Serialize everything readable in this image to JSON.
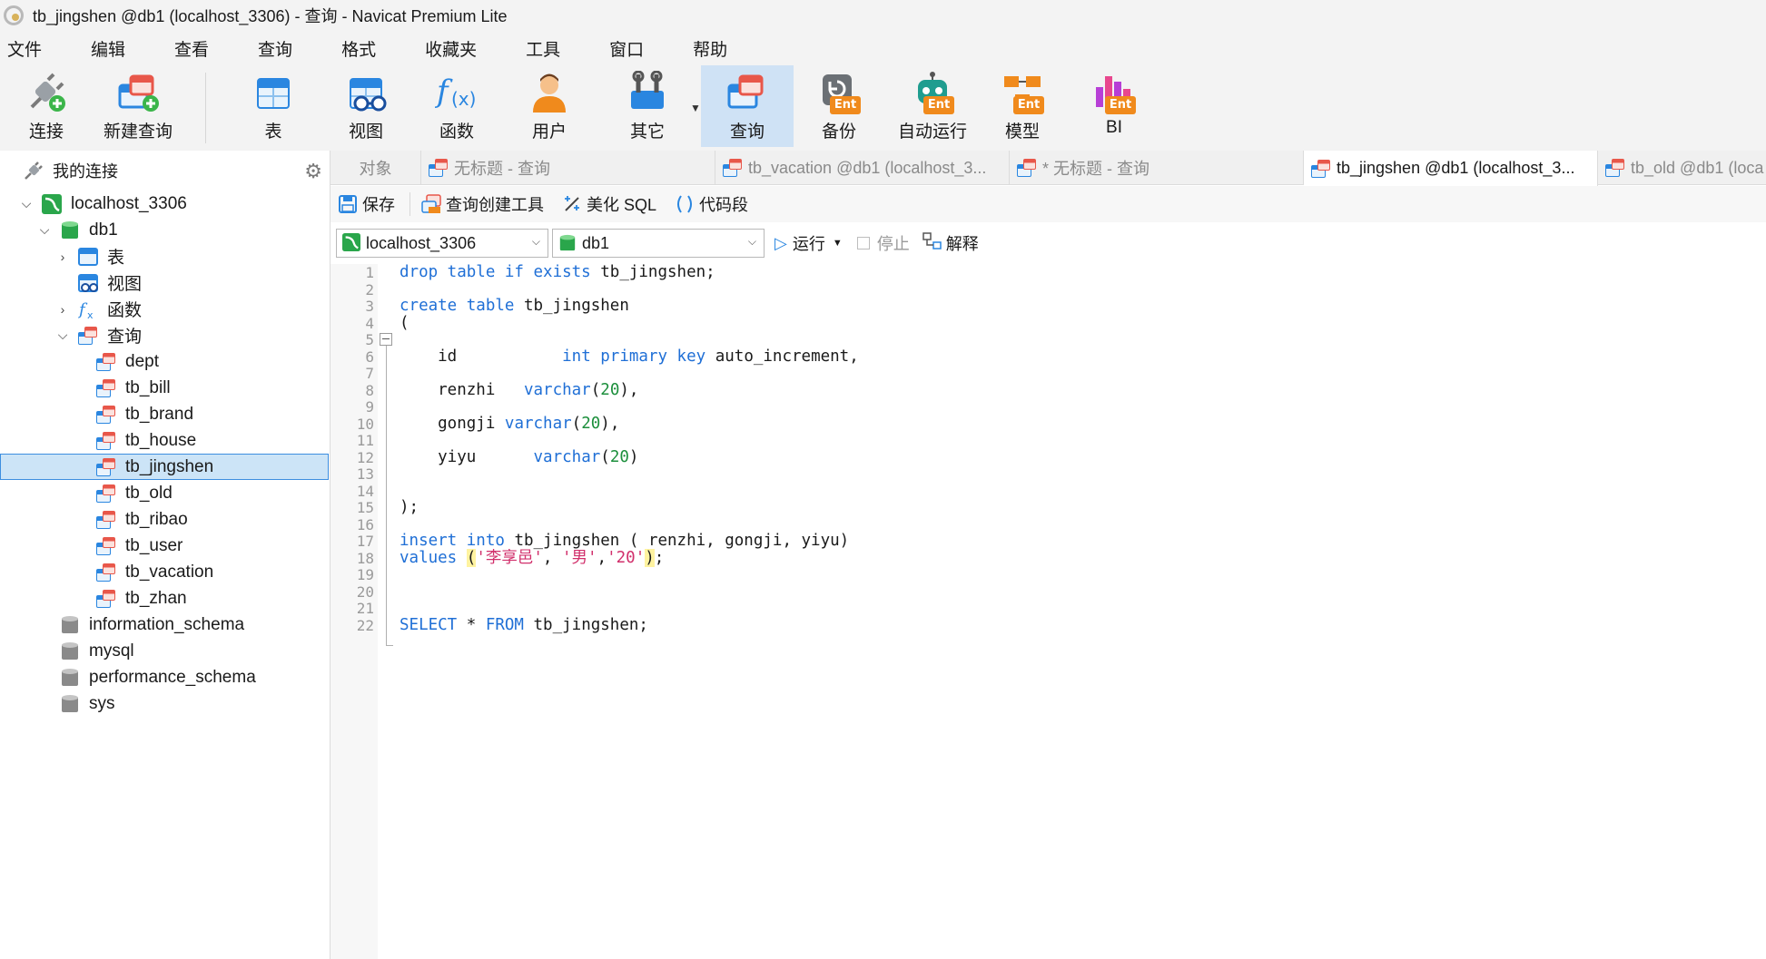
{
  "window": {
    "title": "tb_jingshen @db1 (localhost_3306) - 查询 - Navicat Premium Lite"
  },
  "menu": [
    "文件",
    "编辑",
    "查看",
    "查询",
    "格式",
    "收藏夹",
    "工具",
    "窗口",
    "帮助"
  ],
  "toolbar": {
    "connect": "连接",
    "new_query": "新建查询",
    "table": "表",
    "view": "视图",
    "function": "函数",
    "user": "用户",
    "other": "其它",
    "query": "查询",
    "backup": "备份",
    "automation": "自动运行",
    "model": "模型",
    "bi": "BI",
    "ent_badge": "Ent"
  },
  "sidebar": {
    "header": "我的连接",
    "connection": "localhost_3306",
    "database": "db1",
    "nodes": {
      "tables": "表",
      "views": "视图",
      "functions": "函数",
      "queries": "查询"
    },
    "queries": [
      "dept",
      "tb_bill",
      "tb_brand",
      "tb_house",
      "tb_jingshen",
      "tb_old",
      "tb_ribao",
      "tb_user",
      "tb_vacation",
      "tb_zhan"
    ],
    "selected_query": "tb_jingshen",
    "other_databases": [
      "information_schema",
      "mysql",
      "performance_schema",
      "sys"
    ]
  },
  "tabs": [
    {
      "label": "对象",
      "active": false
    },
    {
      "label": "无标题 - 查询",
      "active": false
    },
    {
      "label": "tb_vacation @db1 (localhost_3...",
      "active": false
    },
    {
      "label": "* 无标题 - 查询",
      "active": false
    },
    {
      "label": "tb_jingshen @db1 (localhost_3...",
      "active": true
    },
    {
      "label": "tb_old @db1 (loca",
      "active": false
    }
  ],
  "query_toolbar": {
    "save": "保存",
    "query_builder": "查询创建工具",
    "beautify": "美化 SQL",
    "snippet": "代码段",
    "connection_value": "localhost_3306",
    "database_value": "db1",
    "run": "运行",
    "stop": "停止",
    "explain": "解释"
  },
  "editor": {
    "lines": [
      {
        "n": "1",
        "tokens": [
          [
            "kw",
            "drop table if exists"
          ],
          [
            "id",
            " tb_jingshen;"
          ]
        ]
      },
      {
        "n": "2",
        "tokens": []
      },
      {
        "n": "3",
        "tokens": [
          [
            "kw",
            "create table"
          ],
          [
            "id",
            " tb_jingshen"
          ]
        ]
      },
      {
        "n": "4",
        "tokens": [
          [
            "id",
            "("
          ]
        ]
      },
      {
        "n": "5",
        "tokens": []
      },
      {
        "n": "6",
        "tokens": [
          [
            "id",
            "    id           "
          ],
          [
            "kw",
            "int primary key"
          ],
          [
            "id",
            " auto_increment,"
          ]
        ]
      },
      {
        "n": "7",
        "tokens": []
      },
      {
        "n": "8",
        "tokens": [
          [
            "id",
            "    renzhi   "
          ],
          [
            "kw",
            "varchar"
          ],
          [
            "id",
            "("
          ],
          [
            "num",
            "20"
          ],
          [
            "id",
            "),"
          ]
        ]
      },
      {
        "n": "9",
        "tokens": []
      },
      {
        "n": "10",
        "tokens": [
          [
            "id",
            "    gongji "
          ],
          [
            "kw",
            "varchar"
          ],
          [
            "id",
            "("
          ],
          [
            "num",
            "20"
          ],
          [
            "id",
            "),"
          ]
        ]
      },
      {
        "n": "11",
        "tokens": []
      },
      {
        "n": "12",
        "tokens": [
          [
            "id",
            "    yiyu      "
          ],
          [
            "kw",
            "varchar"
          ],
          [
            "id",
            "("
          ],
          [
            "num",
            "20"
          ],
          [
            "id",
            ")"
          ]
        ]
      },
      {
        "n": "13",
        "tokens": []
      },
      {
        "n": "14",
        "tokens": []
      },
      {
        "n": "15",
        "tokens": [
          [
            "id",
            ");"
          ]
        ]
      },
      {
        "n": "16",
        "tokens": []
      },
      {
        "n": "17",
        "tokens": [
          [
            "kw",
            "insert into"
          ],
          [
            "id",
            " tb_jingshen ( renzhi, gongji, yiyu)"
          ]
        ]
      },
      {
        "n": "18",
        "tokens": [
          [
            "kw",
            "values"
          ],
          [
            "id",
            " "
          ],
          [
            "hl",
            "("
          ],
          [
            "str",
            "'李享邑'"
          ],
          [
            "id",
            ", "
          ],
          [
            "str",
            "'男'"
          ],
          [
            "id",
            ","
          ],
          [
            "str",
            "'20'"
          ],
          [
            "hl",
            ")"
          ],
          [
            "id",
            ";"
          ]
        ]
      },
      {
        "n": "19",
        "tokens": []
      },
      {
        "n": "20",
        "tokens": []
      },
      {
        "n": "21",
        "tokens": []
      },
      {
        "n": "22",
        "tokens": [
          [
            "kw",
            "SELECT"
          ],
          [
            "id",
            " * "
          ],
          [
            "kw",
            "FROM"
          ],
          [
            "id",
            " tb_jingshen;"
          ]
        ]
      }
    ]
  }
}
